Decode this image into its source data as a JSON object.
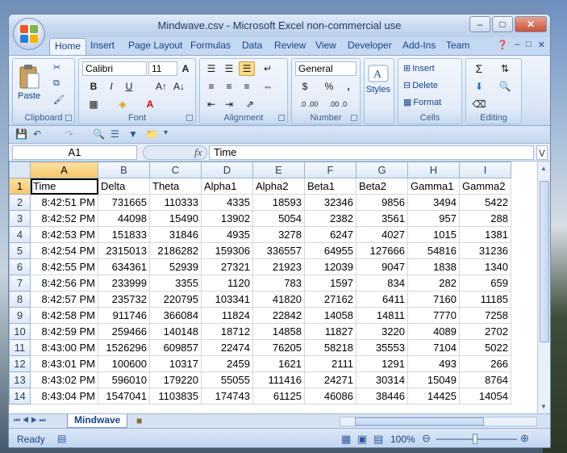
{
  "window": {
    "title": "Mindwave.csv - Microsoft Excel non-commercial use"
  },
  "tabs": [
    "Home",
    "Insert",
    "Page Layout",
    "Formulas",
    "Data",
    "Review",
    "View",
    "Developer",
    "Add-Ins",
    "Team"
  ],
  "ribbon": {
    "clipboard": {
      "label": "Clipboard",
      "paste": "Paste"
    },
    "font": {
      "label": "Font",
      "name": "Calibri",
      "size": "11",
      "bold": "B",
      "italic": "I",
      "underline": "U"
    },
    "alignment": {
      "label": "Alignment"
    },
    "number": {
      "label": "Number",
      "format": "General",
      "currency": "$",
      "percent": "%",
      "comma": ",",
      "inc_decimal": ".0 .00",
      "dec_decimal": ".00 .0"
    },
    "styles": {
      "label": "Styles"
    },
    "cells": {
      "label": "Cells",
      "insert": "Insert",
      "delete": "Delete",
      "format": "Format"
    },
    "editing": {
      "label": "Editing",
      "sum": "Σ"
    }
  },
  "formula_bar": {
    "name_box": "A1",
    "fx": "fx",
    "value": "Time"
  },
  "sheet": {
    "columns": [
      "A",
      "B",
      "C",
      "D",
      "E",
      "F",
      "G",
      "H",
      "I"
    ],
    "rows": [
      {
        "num": "1",
        "cells": [
          "Time",
          "Delta",
          "Theta",
          "Alpha1",
          "Alpha2",
          "Beta1",
          "Beta2",
          "Gamma1",
          "Gamma2"
        ]
      },
      {
        "num": "2",
        "cells": [
          "8:42:51 PM",
          "731665",
          "110333",
          "4335",
          "18593",
          "32346",
          "9856",
          "3494",
          "5422"
        ]
      },
      {
        "num": "3",
        "cells": [
          "8:42:52 PM",
          "44098",
          "15490",
          "13902",
          "5054",
          "2382",
          "3561",
          "957",
          "288"
        ]
      },
      {
        "num": "4",
        "cells": [
          "8:42:53 PM",
          "151833",
          "31846",
          "4935",
          "3278",
          "6247",
          "4027",
          "1015",
          "1381"
        ]
      },
      {
        "num": "5",
        "cells": [
          "8:42:54 PM",
          "2315013",
          "2186282",
          "159306",
          "336557",
          "64955",
          "127666",
          "54816",
          "31236"
        ]
      },
      {
        "num": "6",
        "cells": [
          "8:42:55 PM",
          "634361",
          "52939",
          "27321",
          "21923",
          "12039",
          "9047",
          "1838",
          "1340"
        ]
      },
      {
        "num": "7",
        "cells": [
          "8:42:56 PM",
          "233999",
          "3355",
          "1120",
          "783",
          "1597",
          "834",
          "282",
          "659"
        ]
      },
      {
        "num": "8",
        "cells": [
          "8:42:57 PM",
          "235732",
          "220795",
          "103341",
          "41820",
          "27162",
          "6411",
          "7160",
          "11185"
        ]
      },
      {
        "num": "9",
        "cells": [
          "8:42:58 PM",
          "911746",
          "366084",
          "11824",
          "22842",
          "14058",
          "14811",
          "7770",
          "7258"
        ]
      },
      {
        "num": "10",
        "cells": [
          "8:42:59 PM",
          "259466",
          "140148",
          "18712",
          "14858",
          "11827",
          "3220",
          "4089",
          "2702"
        ]
      },
      {
        "num": "11",
        "cells": [
          "8:43:00 PM",
          "1526296",
          "609857",
          "22474",
          "76205",
          "58218",
          "35553",
          "7104",
          "5022"
        ]
      },
      {
        "num": "12",
        "cells": [
          "8:43:01 PM",
          "100600",
          "10317",
          "2459",
          "1621",
          "2111",
          "1291",
          "493",
          "266"
        ]
      },
      {
        "num": "13",
        "cells": [
          "8:43:02 PM",
          "596010",
          "179220",
          "55055",
          "111416",
          "24271",
          "30314",
          "15049",
          "8764"
        ]
      },
      {
        "num": "14",
        "cells": [
          "8:43:04 PM",
          "1547041",
          "1103835",
          "174743",
          "61125",
          "46086",
          "38446",
          "14425",
          "14054"
        ]
      }
    ],
    "sheet_tab": "Mindwave"
  },
  "status": {
    "ready": "Ready",
    "zoom": "100%"
  },
  "colors": {
    "accent": "#15428b",
    "ribbon": "#dbe7f6",
    "selected": "#fbd986"
  }
}
